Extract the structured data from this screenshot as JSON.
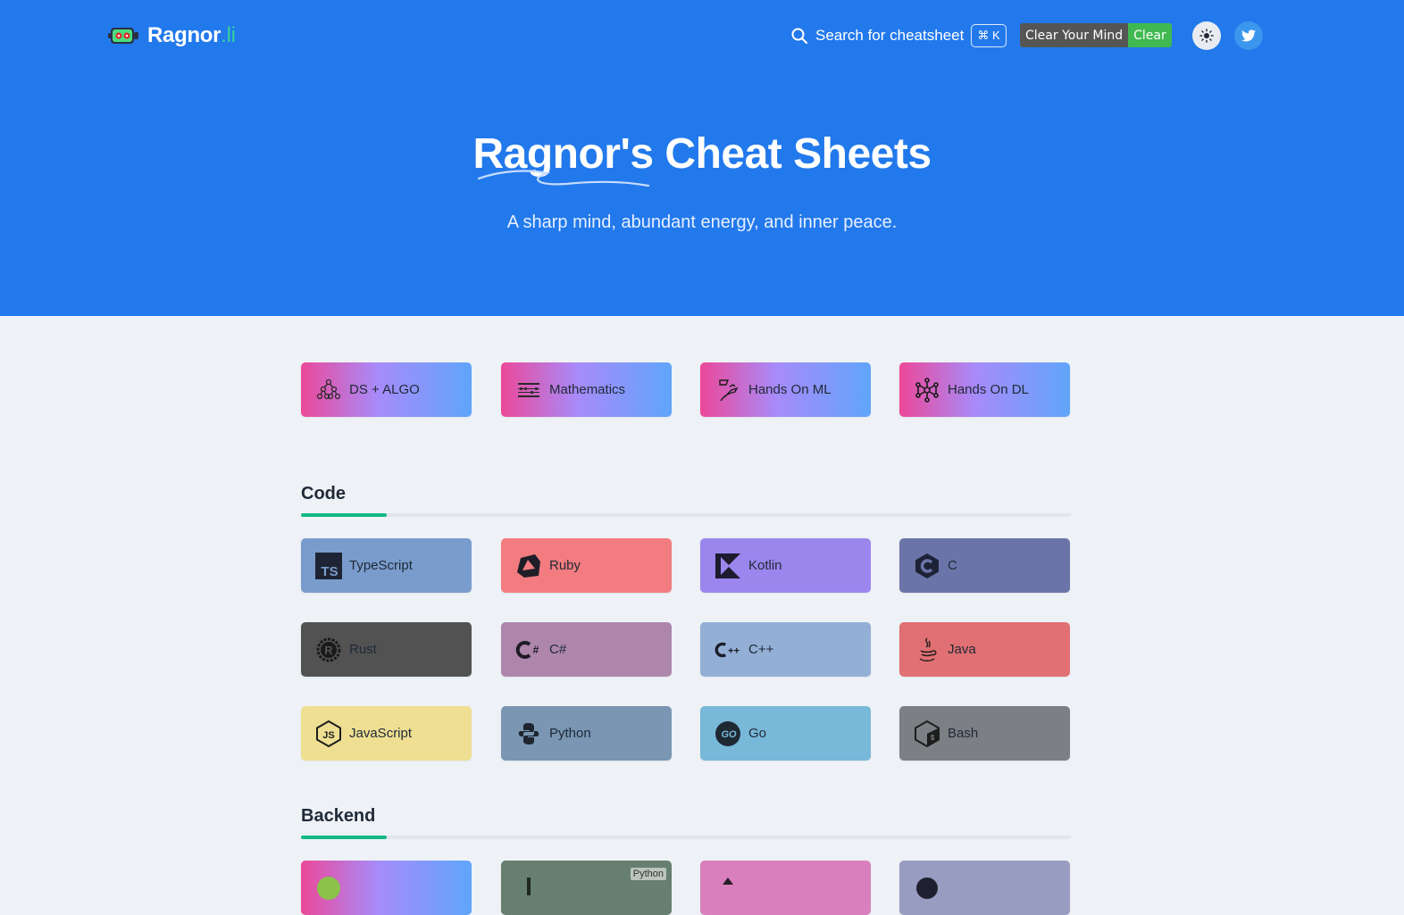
{
  "header": {
    "logo_name": "Ragnor",
    "logo_tld": ".li",
    "search_label": "Search for cheatsheet",
    "search_kbd": "⌘ K",
    "badge_left": "Clear Your Mind",
    "badge_right": "Clear",
    "theme_icon": "sun-icon",
    "social_icon": "twitter-icon"
  },
  "hero": {
    "title": "Ragnor's Cheat Sheets",
    "subtitle": "A sharp mind, abundant energy, and inner peace."
  },
  "featured": [
    {
      "label": "DS + ALGO",
      "icon": "tree-graph-icon"
    },
    {
      "label": "Mathematics",
      "icon": "abacus-icon"
    },
    {
      "label": "Hands On ML",
      "icon": "ml-book-icon"
    },
    {
      "label": "Hands On DL",
      "icon": "neural-net-icon"
    }
  ],
  "sections": [
    {
      "title": "Code",
      "items": [
        {
          "label": "TypeScript",
          "icon": "typescript-icon",
          "color": "#7a9ccd"
        },
        {
          "label": "Ruby",
          "icon": "ruby-icon",
          "color": "#f27c7f"
        },
        {
          "label": "Kotlin",
          "icon": "kotlin-icon",
          "color": "#9b86ee"
        },
        {
          "label": "C",
          "icon": "c-icon",
          "color": "#6b74a8"
        },
        {
          "label": "Rust",
          "icon": "rust-icon",
          "color": "#525253"
        },
        {
          "label": "C#",
          "icon": "csharp-icon",
          "color": "#ae86ac"
        },
        {
          "label": "C++",
          "icon": "cpp-icon",
          "color": "#93afd5"
        },
        {
          "label": "Java",
          "icon": "java-icon",
          "color": "#e07073"
        },
        {
          "label": "JavaScript",
          "icon": "javascript-icon",
          "color": "#eedf92"
        },
        {
          "label": "Python",
          "icon": "python-icon",
          "color": "#7a96b3"
        },
        {
          "label": "Go",
          "icon": "go-icon",
          "color": "#78b8d8"
        },
        {
          "label": "Bash",
          "icon": "bash-icon",
          "color": "#7c7f84"
        }
      ]
    },
    {
      "title": "Backend",
      "items": [
        {
          "label": "",
          "icon": "nodejs-icon",
          "color": "gradient"
        },
        {
          "label": "",
          "icon": "django-icon",
          "color": "#667f70",
          "tag": "Python"
        },
        {
          "label": "",
          "icon": "backend-icon",
          "color": "#d97fbd"
        },
        {
          "label": "",
          "icon": "backend-icon-2",
          "color": "#989cc0"
        }
      ]
    }
  ]
}
